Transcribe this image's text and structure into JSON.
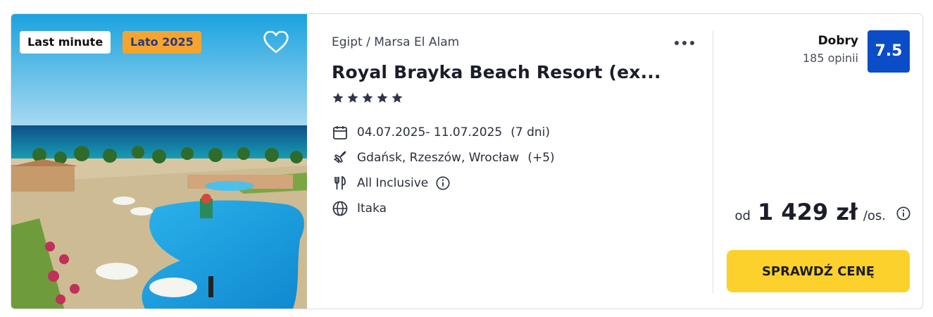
{
  "badges": {
    "last_minute": "Last minute",
    "season": "Lato 2025"
  },
  "hotel": {
    "breadcrumb": "Egipt / Marsa El Alam",
    "name": "Royal Brayka Beach Resort (ex...",
    "stars": 5
  },
  "details": {
    "dates": "04.07.2025- 11.07.2025",
    "duration": "(7 dni)",
    "departure": "Gdańsk, Rzeszów, Wrocław",
    "departure_extra": "(+5)",
    "board": "All Inclusive",
    "operator": "Itaka"
  },
  "rating": {
    "label": "Dobry",
    "reviews": "185 opinii",
    "score": "7.5"
  },
  "price": {
    "prefix": "od",
    "amount": "1 429 zł",
    "unit": "/os."
  },
  "cta": {
    "label": "SPRAWDŹ CENĘ"
  },
  "colors": {
    "score_bg": "#0b4cc7",
    "cta_bg": "#fdd12b",
    "season_badge": "#f7a42f"
  },
  "icons": [
    "heart-icon",
    "more-dots-icon",
    "star-icon",
    "calendar-icon",
    "plane-icon",
    "cutlery-icon",
    "info-icon",
    "globe-icon"
  ]
}
